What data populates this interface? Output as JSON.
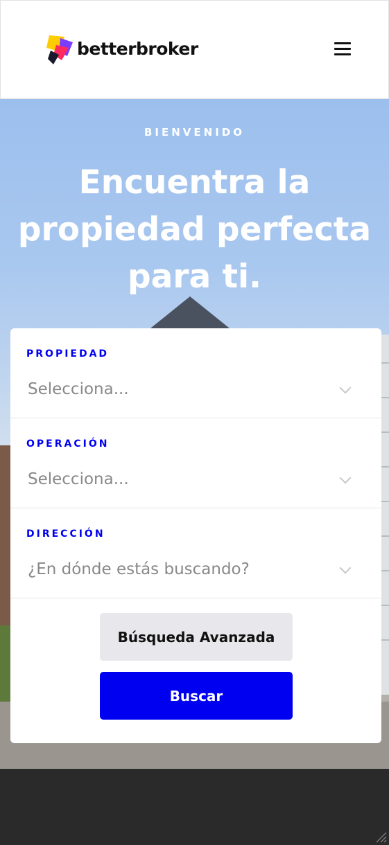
{
  "header": {
    "brand": "betterbroker",
    "logo_icon": "betterbroker-logo-icon",
    "menu_icon": "hamburger-menu-icon"
  },
  "hero": {
    "eyebrow": "BIENVENIDO",
    "headline": "Encuentra la propiedad perfecta para ti."
  },
  "search_form": {
    "fields": [
      {
        "label": "PROPIEDAD",
        "value": "Selecciona..."
      },
      {
        "label": "OPERACIÓN",
        "value": "Selecciona..."
      },
      {
        "label": "DIRECCIÓN",
        "value": "¿En dónde estás buscando?"
      }
    ],
    "advanced_label": "Búsqueda Avanzada",
    "submit_label": "Buscar"
  },
  "colors": {
    "accent": "#0000f0",
    "secondary_button": "#e8e8ec",
    "footer": "#2a2a2a"
  }
}
